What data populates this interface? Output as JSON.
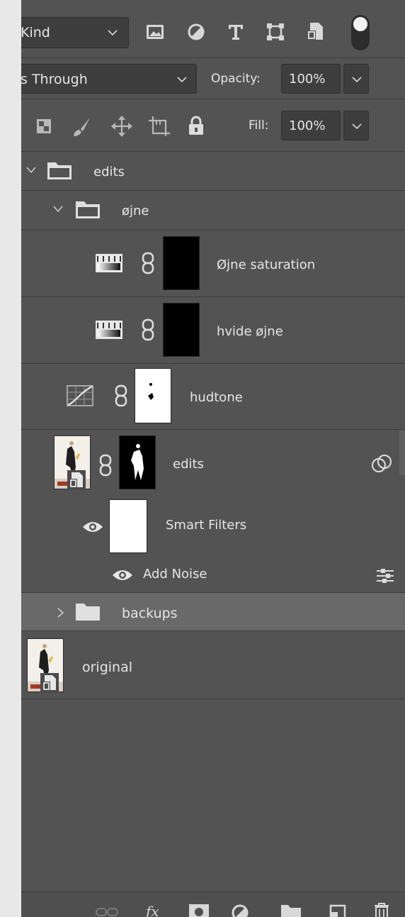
{
  "filter_bar": {
    "kind_label": "Kind",
    "filter_icons": [
      "image-filter-icon",
      "adjustment-filter-icon",
      "type-filter-icon",
      "shape-filter-icon",
      "smart-object-filter-icon",
      "filter-toggle-icon"
    ]
  },
  "blend_bar": {
    "blend_mode": "s Through",
    "opacity_label": "Opacity:",
    "opacity_value": "100%"
  },
  "lock_bar": {
    "lock_icons": [
      "lock-transparent-pixels-icon",
      "lock-image-pixels-icon",
      "lock-position-icon",
      "lock-artboard-icon",
      "lock-all-icon"
    ],
    "fill_label": "Fill:",
    "fill_value": "100%"
  },
  "layers": [
    {
      "name": "edits",
      "type": "group",
      "expanded": true
    },
    {
      "name": "øjne",
      "type": "group",
      "expanded": true
    },
    {
      "name": "Øjne saturation",
      "type": "gradient-map-adjustment"
    },
    {
      "name": "hvide øjne",
      "type": "gradient-map-adjustment"
    },
    {
      "name": "hudtone",
      "type": "curves-adjustment"
    },
    {
      "name": "edits",
      "type": "smart-object",
      "has_filters": true
    },
    {
      "name": "Smart Filters",
      "type": "smart-filters",
      "visible": true
    },
    {
      "name": "Add Noise",
      "type": "filter",
      "visible": true
    },
    {
      "name": "backups",
      "type": "group",
      "expanded": false,
      "selected": true
    },
    {
      "name": "original",
      "type": "smart-object"
    }
  ],
  "footer_icons": [
    "link-layers-icon",
    "fx-icon",
    "add-mask-icon",
    "new-adjustment-icon",
    "new-group-icon",
    "new-layer-icon",
    "delete-icon"
  ],
  "colors": {
    "panel_bg": "#535353",
    "selected_row_bg": "#696969",
    "text": "#e6e6e6",
    "field_bg": "#3e3e3e"
  }
}
